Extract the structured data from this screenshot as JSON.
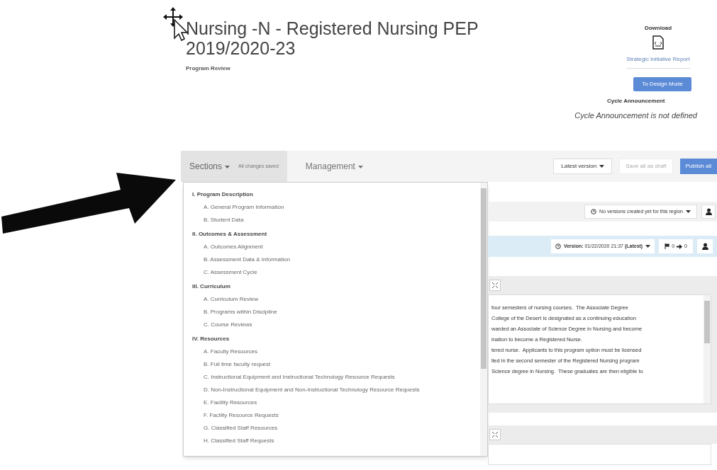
{
  "header": {
    "title": "Nursing -N - Registered Nursing PEP 2019/2020-23",
    "subtitle": "Program Review",
    "download_label": "Download",
    "report_link": "Strategic Initiative Report",
    "design_mode_button": "To Design Mode",
    "cycle_announcement": {
      "heading": "Cycle Announcement",
      "text": "Cycle Announcement is not defined"
    }
  },
  "navbar": {
    "tabs": [
      {
        "label": "Sections",
        "selected": true,
        "status": "All changes saved"
      },
      {
        "label": "Management",
        "selected": false
      }
    ],
    "version_button": "Latest version",
    "draft_button": "Save all as draft",
    "publish_button": "Publish all"
  },
  "sections_menu": [
    {
      "title": "I. Program Description",
      "items": [
        "A. General Program Information",
        "B. Student Data"
      ]
    },
    {
      "title": "II. Outcomes & Assessment",
      "items": [
        "A. Outcomes Alignment",
        "B. Assessment Data & Information",
        "C. Assessment Cycle"
      ]
    },
    {
      "title": "III. Curriculum",
      "items": [
        "A. Curriculum Review",
        "B. Programs within Discipline",
        "C. Course Reviews"
      ]
    },
    {
      "title": "IV. Resources",
      "items": [
        "A. Faculty Resources",
        "B. Full time faculty request",
        "C. Instructional Equipment and Instructional Technology Resource Requests",
        "D. Non-Instructional Equipment and Non-Instructional Technology Resource Requests",
        "E. Facility Resources",
        "F. Facility Resource Requests",
        "G. Classified Staff Resources",
        "H. Classified Staff Requests"
      ]
    }
  ],
  "region_versions_button": "No versions created yet for this region",
  "version_bar": {
    "version": "**Version:** 01/22/2020 21:37 **(Latest)**",
    "flags": "0",
    "arrows": "0"
  },
  "editor_lines": [
    "four semesters of nursing courses.  The Associate Degree",
    "College of the Desert is designated as a continuing education",
    "warded an Associate of Science Degree in Nursing and become",
    "ination to become a Registered Nurse.",
    "tered nurse.  Applicants to this program option must be licensed",
    "lled in the second semester of the Registered Nursing program",
    "Science degree in Nursing.  These graduates are then eligible to"
  ]
}
